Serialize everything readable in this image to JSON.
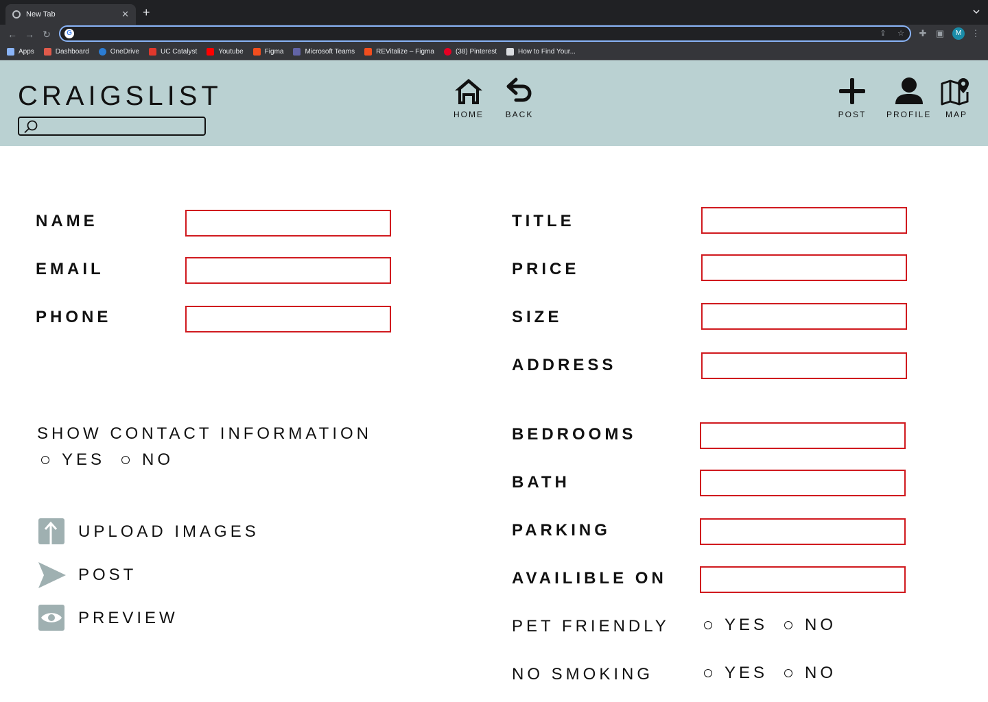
{
  "browser": {
    "tab_title": "New Tab",
    "tab_close": "✕",
    "new_tab": "+",
    "address_value": "",
    "profile_initial": "M",
    "bookmarks": [
      {
        "label": "Apps",
        "color": "#8ab4f8"
      },
      {
        "label": "Dashboard",
        "color": "#e05a4b"
      },
      {
        "label": "OneDrive",
        "color": "#2b7cd3"
      },
      {
        "label": "UC Catalyst",
        "color": "#e0382c"
      },
      {
        "label": "Youtube",
        "color": "#ff0000"
      },
      {
        "label": "Figma",
        "color": "#f24e1e"
      },
      {
        "label": "Microsoft Teams",
        "color": "#6264a7"
      },
      {
        "label": "REVitalize – Figma",
        "color": "#f24e1e"
      },
      {
        "label": "(38) Pinterest",
        "color": "#e60023"
      },
      {
        "label": "How to Find Your...",
        "color": "#dadce0"
      }
    ]
  },
  "header": {
    "logo": "CRAIGSLIST",
    "search_value": "",
    "nav": {
      "home": "HOME",
      "back": "BACK",
      "post": "POST",
      "profile": "PROFILE",
      "map": "MAP"
    },
    "background": "#bad1d2"
  },
  "contact": {
    "name_label": "NAME",
    "email_label": "EMAIL",
    "phone_label": "PHONE",
    "name_value": "",
    "email_value": "",
    "phone_value": "",
    "show_contact_label": "SHOW CONTACT INFORMATION",
    "yes": "YES",
    "no": "NO"
  },
  "actions": {
    "upload": "UPLOAD IMAGES",
    "post": "POST",
    "preview": "PREVIEW",
    "icon_color": "#9fb0b1"
  },
  "listing": {
    "title_label": "TITLE",
    "price_label": "PRICE",
    "size_label": "SIZE",
    "address_label": "ADDRESS",
    "bedrooms_label": "BEDROOMS",
    "bath_label": "BATH",
    "parking_label": "PARKING",
    "available_label": "AVAILIBLE ON",
    "pet_label": "PET FRIENDLY",
    "smoking_label": "NO SMOKING",
    "yes": "YES",
    "no": "NO",
    "field_border_color": "#d0191e"
  }
}
